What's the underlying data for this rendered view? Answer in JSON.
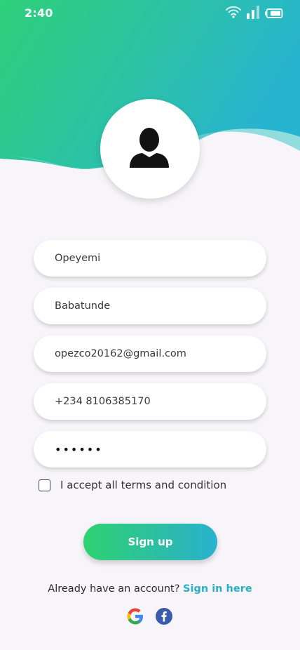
{
  "status_bar": {
    "time": "2:40",
    "icons": [
      "wifi-icon",
      "signal-icon",
      "battery-icon"
    ]
  },
  "form": {
    "first_name": {
      "value": "Opeyemi"
    },
    "last_name": {
      "value": "Babatunde"
    },
    "email": {
      "value": "opezco20162@gmail.com"
    },
    "phone": {
      "value": "+234 8106385170"
    },
    "password": {
      "value": "••••••"
    }
  },
  "terms": {
    "label": "I accept all terms and condition",
    "checked": false
  },
  "signup_button": {
    "label": "Sign up"
  },
  "account": {
    "prompt": "Already have an account?",
    "link": "Sign in here"
  },
  "social": [
    "google-icon",
    "facebook-icon"
  ],
  "colors": {
    "gradient_start": "#2ed272",
    "gradient_end": "#28b3cf",
    "link": "#2ab0c3",
    "background": "#f7f5f9"
  }
}
